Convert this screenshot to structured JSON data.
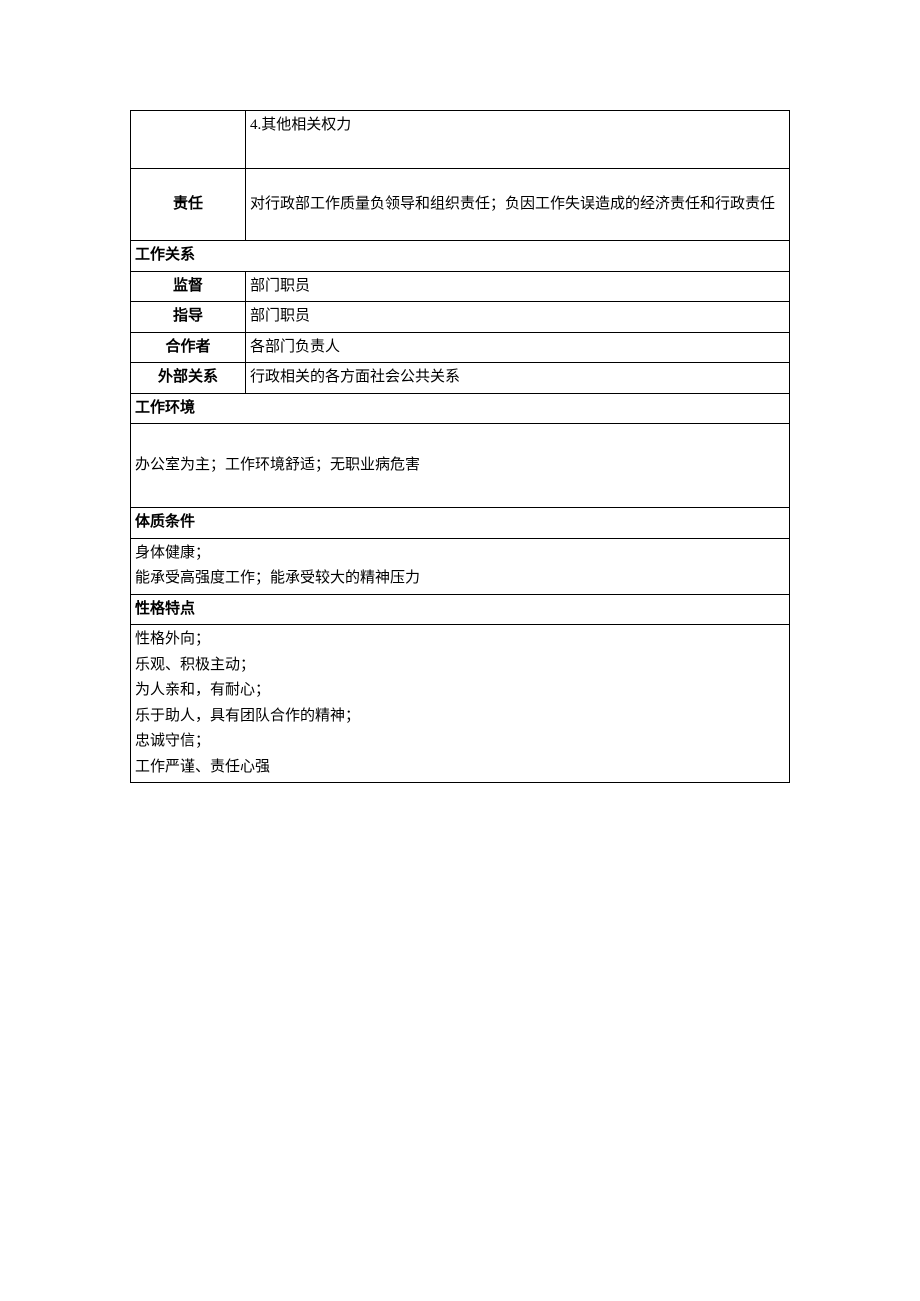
{
  "rows": {
    "other_rights": "4.其他相关权力",
    "responsibility_label": "责任",
    "responsibility_content": "对行政部工作质量负领导和组织责任；负因工作失误造成的经济责任和行政责任"
  },
  "work_relations": {
    "header": "工作关系",
    "supervise_label": "监督",
    "supervise_value": "部门职员",
    "guide_label": "指导",
    "guide_value": "部门职员",
    "coop_label": "合作者",
    "coop_value": "各部门负责人",
    "external_label": "外部关系",
    "external_value": "行政相关的各方面社会公共关系"
  },
  "work_env": {
    "header": "工作环境",
    "content": "办公室为主；工作环境舒适；无职业病危害"
  },
  "physical": {
    "header": "体质条件",
    "line1": "身体健康；",
    "line2": "能承受高强度工作；能承受较大的精神压力"
  },
  "personality": {
    "header": "性格特点",
    "line1": "性格外向；",
    "line2": "乐观、积极主动；",
    "line3": "为人亲和，有耐心；",
    "line4": "乐于助人，具有团队合作的精神；",
    "line5": "忠诚守信；",
    "line6": "工作严谨、责任心强"
  }
}
